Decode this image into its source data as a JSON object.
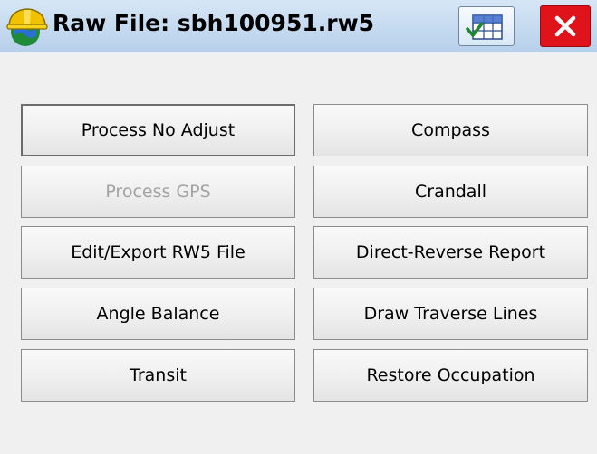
{
  "window": {
    "title": "Raw File: sbh100951.rw5",
    "app_icon": "hardhat-globe-icon",
    "menu_icon": "checklist-grid-icon",
    "close_icon": "close-x-icon"
  },
  "buttons": {
    "left": [
      {
        "label": "Process No Adjust",
        "state": "focused"
      },
      {
        "label": "Process GPS",
        "state": "disabled"
      },
      {
        "label": "Edit/Export RW5 File",
        "state": "normal"
      },
      {
        "label": "Angle Balance",
        "state": "normal"
      },
      {
        "label": "Transit",
        "state": "normal"
      }
    ],
    "right": [
      {
        "label": "Compass",
        "state": "normal"
      },
      {
        "label": "Crandall",
        "state": "normal"
      },
      {
        "label": "Direct-Reverse Report",
        "state": "normal"
      },
      {
        "label": "Draw Traverse Lines",
        "state": "normal"
      },
      {
        "label": "Restore Occupation",
        "state": "normal"
      }
    ]
  },
  "colors": {
    "titlebar": "#c6dcf2",
    "close_button": "#e0121a",
    "disabled_text": "#a3a3a3"
  }
}
